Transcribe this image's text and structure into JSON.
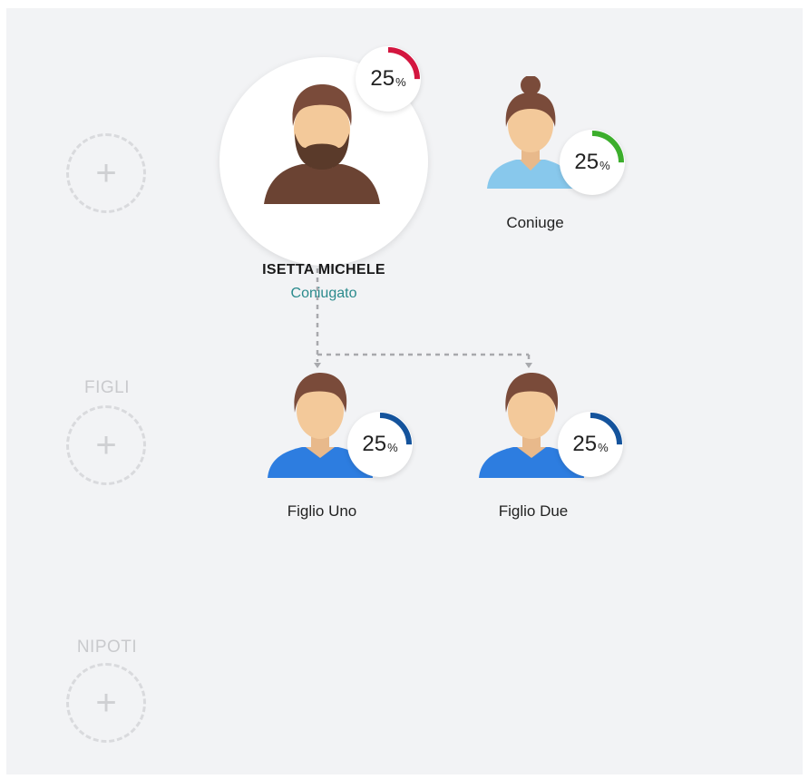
{
  "colors": {
    "background": "#f2f3f5",
    "main_ring": "#d3163f",
    "spouse_ring": "#3cae2c",
    "child_ring": "#14539c",
    "status_text": "#2a8a8c"
  },
  "add_slots": [
    {
      "label": "",
      "icon": "plus-icon",
      "plus": "+"
    },
    {
      "label": "FIGLI",
      "icon": "plus-icon",
      "plus": "+"
    },
    {
      "label": "NIPOTI",
      "icon": "plus-icon",
      "plus": "+"
    }
  ],
  "main_person": {
    "name": "ISETTA MICHELE",
    "status": "Coniugato",
    "share": "25",
    "share_unit": "%",
    "share_fraction": 0.25,
    "avatar": "bearded-man-avatar-icon"
  },
  "spouse": {
    "name": "Coniuge",
    "share": "25",
    "share_unit": "%",
    "share_fraction": 0.25,
    "avatar": "woman-avatar-icon"
  },
  "children": [
    {
      "name": "Figlio Uno",
      "share": "25",
      "share_unit": "%",
      "share_fraction": 0.25,
      "avatar": "boy-avatar-icon"
    },
    {
      "name": "Figlio Due",
      "share": "25",
      "share_unit": "%",
      "share_fraction": 0.25,
      "avatar": "boy-avatar-icon"
    }
  ]
}
